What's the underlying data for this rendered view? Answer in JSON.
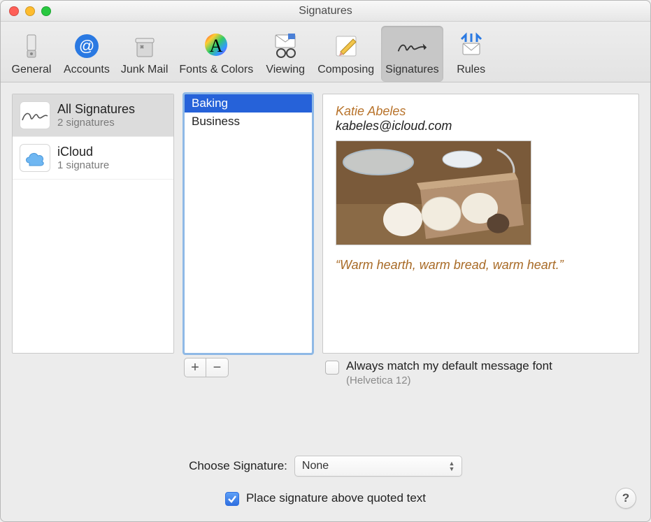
{
  "window": {
    "title": "Signatures"
  },
  "toolbar": {
    "items": [
      {
        "label": "General"
      },
      {
        "label": "Accounts"
      },
      {
        "label": "Junk Mail"
      },
      {
        "label": "Fonts & Colors"
      },
      {
        "label": "Viewing"
      },
      {
        "label": "Composing"
      },
      {
        "label": "Signatures"
      },
      {
        "label": "Rules"
      }
    ],
    "active_index": 6
  },
  "accounts": [
    {
      "title": "All Signatures",
      "subtitle": "2 signatures",
      "icon": "signature",
      "selected": true
    },
    {
      "title": "iCloud",
      "subtitle": "1 signature",
      "icon": "cloud",
      "selected": false
    }
  ],
  "signatures": {
    "items": [
      {
        "name": "Baking",
        "selected": true
      },
      {
        "name": "Business",
        "selected": false
      }
    ],
    "buttons": {
      "add": "+",
      "remove": "−"
    }
  },
  "preview": {
    "name": "Katie Abeles",
    "email": "kabeles@icloud.com",
    "quote": "“Warm hearth, warm bread, warm heart.”",
    "image_alt": "baking-photo"
  },
  "options": {
    "always_match_label": "Always match my default message font",
    "always_match_checked": false,
    "default_font_hint": "(Helvetica 12)",
    "choose_label": "Choose Signature:",
    "choose_value": "None",
    "place_above_label": "Place signature above quoted text",
    "place_above_checked": true
  },
  "help": {
    "symbol": "?"
  }
}
